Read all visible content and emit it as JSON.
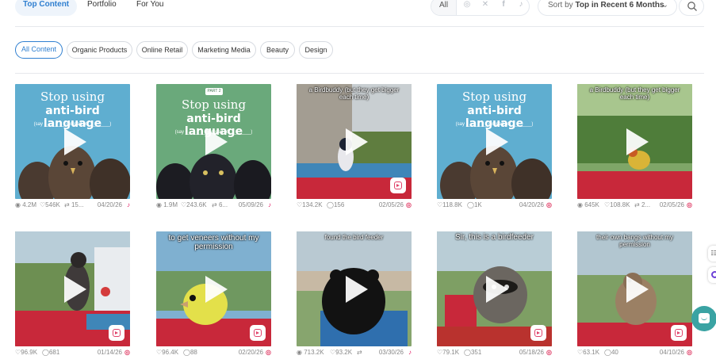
{
  "nav": {
    "tabs": [
      {
        "label": "Top Content",
        "active": true
      },
      {
        "label": "Portfolio",
        "active": false
      },
      {
        "label": "For You",
        "active": false
      }
    ],
    "network_filter": {
      "all_label": "All",
      "icons": [
        "instagram-icon",
        "x-icon",
        "facebook-icon",
        "tiktok-icon"
      ]
    },
    "sort": {
      "prefix": "Sort by ",
      "value": "Top in Recent 6 Months"
    },
    "search_icon": "search-icon"
  },
  "categories": [
    {
      "label": "All Content",
      "active": true
    },
    {
      "label": "Organic Products",
      "active": false
    },
    {
      "label": "Online Retail",
      "active": false
    },
    {
      "label": "Marketing Media",
      "active": false
    },
    {
      "label": "Beauty",
      "active": false
    },
    {
      "label": "Design",
      "active": false
    }
  ],
  "colors": {
    "accent": "#2f7fd0",
    "tiktok": "#e0145c",
    "instagram": "#e0426a",
    "chat": "#3aa3a3"
  },
  "cards": [
    {
      "title1": "Stop using",
      "title2": "anti-bird language",
      "sub": "(say ________ instead of ________)",
      "views": "4.2M",
      "likes": "546K",
      "shares": "15...",
      "date": "04/20/26",
      "platform": "tiktok"
    },
    {
      "part": "PART 2",
      "title1": "Stop using",
      "title2": "anti-bird language",
      "sub": "(say ________ instead of ________)",
      "views": "1.9M",
      "likes": "243.6K",
      "shares": "6...",
      "date": "05/09/26",
      "platform": "tiktok"
    },
    {
      "overlay": "a Birdbuddy (but they get bigger each time)",
      "likes": "134.2K",
      "comments": "156",
      "date": "02/05/26",
      "platform": "instagram"
    },
    {
      "title1": "Stop using",
      "title2": "anti-bird language",
      "sub": "(say ________ instead of ________)",
      "likes": "118.8K",
      "comments": "1K",
      "date": "04/20/26",
      "platform": "instagram"
    },
    {
      "overlay": "a Birdbuddy (but they get bigger each time)",
      "views": "645K",
      "likes": "108.8K",
      "shares": "2...",
      "date": "02/05/26",
      "platform": "instagram"
    },
    {
      "likes": "96.9K",
      "comments": "681",
      "date": "01/14/26",
      "platform": "instagram"
    },
    {
      "overlay": "to get veneers without my permission",
      "likes": "96.4K",
      "comments": "88",
      "date": "02/20/26",
      "platform": "instagram"
    },
    {
      "overlay": "found the bird feeder",
      "views": "713.2K",
      "likes": "93.2K",
      "date": "03/30/26",
      "platform": "tiktok"
    },
    {
      "overlay": "Sir, this is a birdfeeder",
      "likes": "79.1K",
      "comments": "351",
      "date": "05/18/26",
      "platform": "instagram"
    },
    {
      "overlay": "their own bangs without my permission",
      "likes": "63.1K",
      "comments": "40",
      "date": "04/10/26",
      "platform": "instagram"
    }
  ],
  "edge_widget_label": "☷"
}
